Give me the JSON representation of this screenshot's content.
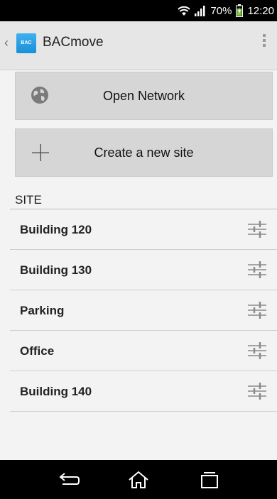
{
  "status_bar": {
    "battery": "70%",
    "time": "12:20"
  },
  "app": {
    "icon_text": "BAC",
    "title": "BACmove"
  },
  "buttons": {
    "open_network": "Open Network",
    "create_site": "Create a new site"
  },
  "site_section": {
    "header": "SITE",
    "items": [
      {
        "label": "Building 120"
      },
      {
        "label": "Building 130"
      },
      {
        "label": "Parking"
      },
      {
        "label": "Office"
      },
      {
        "label": "Building 140"
      }
    ]
  }
}
